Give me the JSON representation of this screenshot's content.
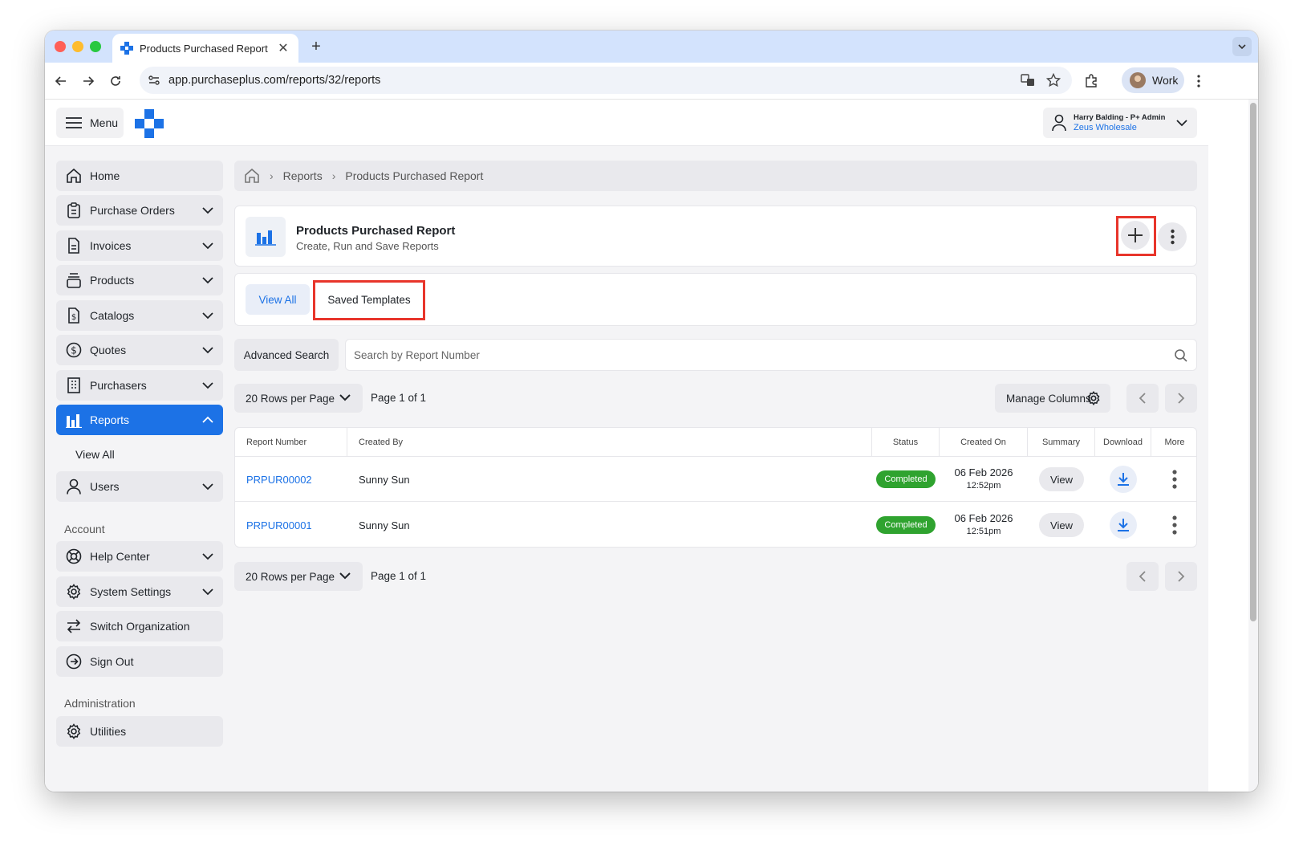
{
  "browser": {
    "tab_title": "Products Purchased Report",
    "url": "app.purchaseplus.com/reports/32/reports",
    "profile_label": "Work"
  },
  "header": {
    "menu_label": "Menu",
    "user_name": "Harry Balding - P+ Admin",
    "user_org": "Zeus Wholesale"
  },
  "sidebar": {
    "items": [
      {
        "label": "Home",
        "icon": "home-icon"
      },
      {
        "label": "Purchase Orders",
        "icon": "clipboard-icon"
      },
      {
        "label": "Invoices",
        "icon": "document-icon"
      },
      {
        "label": "Products",
        "icon": "box-stack-icon"
      },
      {
        "label": "Catalogs",
        "icon": "catalog-dollar-icon"
      },
      {
        "label": "Quotes",
        "icon": "dollar-circle-icon"
      },
      {
        "label": "Purchasers",
        "icon": "building-icon"
      },
      {
        "label": "Reports",
        "icon": "bar-chart-icon"
      },
      {
        "label": "Users",
        "icon": "user-icon"
      }
    ],
    "reports_sub": "View All",
    "account_heading": "Account",
    "account_items": [
      {
        "label": "Help Center"
      },
      {
        "label": "System Settings"
      },
      {
        "label": "Switch Organization"
      },
      {
        "label": "Sign Out"
      }
    ],
    "admin_heading": "Administration",
    "admin_items": [
      {
        "label": "Utilities"
      }
    ]
  },
  "breadcrumb": {
    "items": [
      "Reports",
      "Products Purchased Report"
    ]
  },
  "report_header": {
    "title": "Products Purchased Report",
    "subtitle": "Create, Run and Save Reports"
  },
  "tabs": {
    "view_all": "View All",
    "saved_templates": "Saved Templates"
  },
  "search": {
    "advanced_label": "Advanced Search",
    "placeholder": "Search by Report Number"
  },
  "pagination": {
    "rows_per_page": "20 Rows per Page",
    "page_info": "Page 1 of 1",
    "manage_columns": "Manage Columns"
  },
  "table": {
    "headers": [
      "Report Number",
      "Created By",
      "Status",
      "Created On",
      "Summary",
      "Download",
      "More"
    ],
    "rows": [
      {
        "report_number": "PRPUR00002",
        "created_by": "Sunny Sun",
        "status": "Completed",
        "date": "06 Feb 2026",
        "time": "12:52pm",
        "summary": "View"
      },
      {
        "report_number": "PRPUR00001",
        "created_by": "Sunny Sun",
        "status": "Completed",
        "date": "06 Feb 2026",
        "time": "12:51pm",
        "summary": "View"
      }
    ]
  },
  "colors": {
    "accent": "#1c72e6",
    "status_completed": "#2fa32f",
    "highlight": "#e8352b"
  }
}
